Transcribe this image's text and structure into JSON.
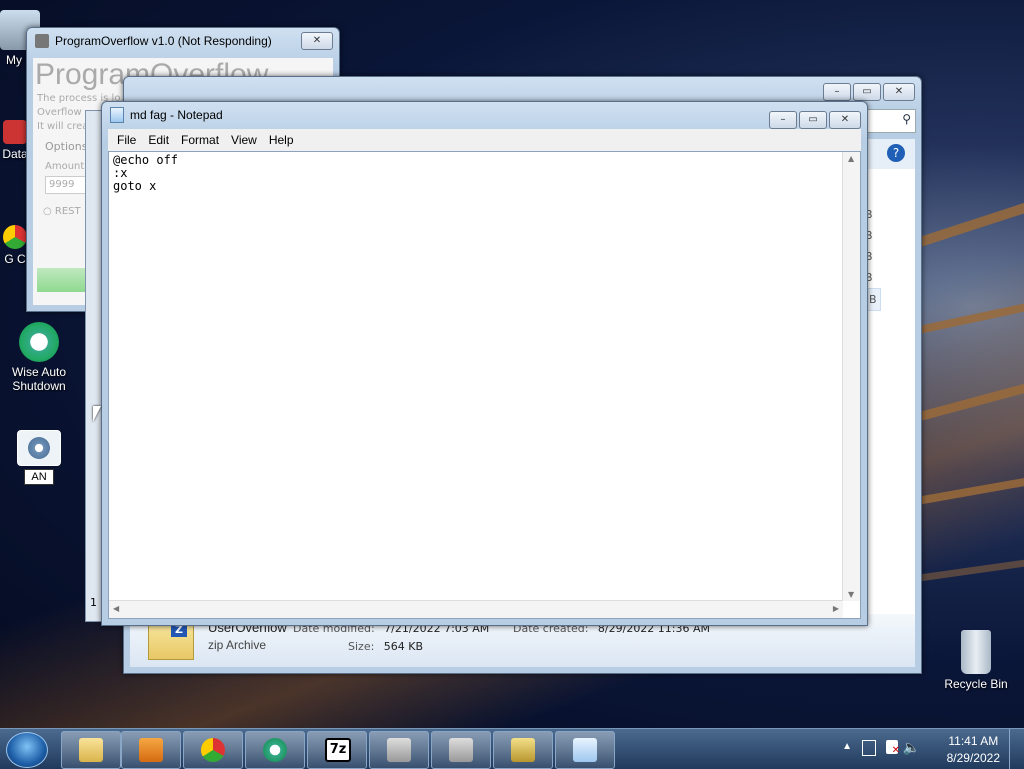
{
  "desktop": {
    "icons": [
      {
        "label": "My C",
        "name": "my-computer"
      },
      {
        "label": "Data",
        "name": "data"
      },
      {
        "label": "G C",
        "name": "google-chrome"
      },
      {
        "label": "Wise Auto Shutdown",
        "name": "wise-auto-shutdown"
      },
      {
        "label": "AN",
        "name": "an-rename"
      },
      {
        "label": "Recycle Bin",
        "name": "recycle-bin"
      }
    ]
  },
  "programoverflow": {
    "title": "ProgramOverflow v1.0 (Not Responding)",
    "heading": "ProgramOverflow",
    "desc_lines": [
      "The process is lo",
      "Overflow",
      "It will crea"
    ],
    "options_label": "Options",
    "amount_label": "Amount",
    "amount_value": "9999",
    "restart_label": "REST"
  },
  "explorer": {
    "sizes": [
      "B",
      "B",
      "B",
      "B",
      "B"
    ],
    "file": {
      "name": "UserOverflow",
      "type": "zip Archive",
      "modified_label": "Date modified:",
      "modified_value": "7/21/2022 7:03 AM",
      "created_label": "Date created:",
      "created_value": "8/29/2022 11:36 AM",
      "size_label": "Size:",
      "size_value": "564 KB"
    },
    "left_char": "1"
  },
  "notepad": {
    "title": "md fag - Notepad",
    "menu": [
      "File",
      "Edit",
      "Format",
      "View",
      "Help"
    ],
    "content": "@echo off\n:x\ngoto x"
  },
  "taskbar": {
    "clock_time": "11:41 AM",
    "clock_date": "8/29/2022",
    "sevenzip_label": "7z"
  }
}
